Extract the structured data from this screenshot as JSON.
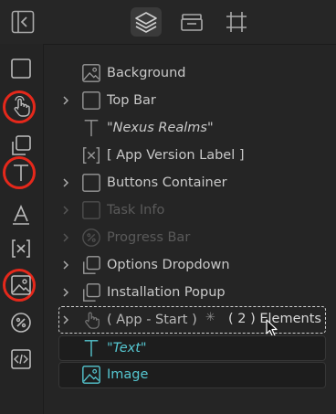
{
  "top_tabs": [
    {
      "name": "layers-icon",
      "active": true
    },
    {
      "name": "assets-icon",
      "active": false
    },
    {
      "name": "frame-icon",
      "active": false
    }
  ],
  "toolbar_tools": [
    "box-icon",
    "touch-icon",
    "copy-icon",
    "text-icon",
    "font-icon",
    "variable-icon",
    "image-icon",
    "percent-icon",
    "code-icon"
  ],
  "highlighted_tools": [
    "touch-icon",
    "text-icon",
    "image-icon"
  ],
  "tree": [
    {
      "label": "Background",
      "icon": "image"
    },
    {
      "label": "Top Bar",
      "icon": "box"
    },
    {
      "label": "\"Nexus Realms\"",
      "icon": "text"
    },
    {
      "label": "[ App Version Label ]",
      "icon": "variable"
    },
    {
      "label": "Buttons Container",
      "icon": "box"
    },
    {
      "label": "Task Info",
      "icon": "box"
    },
    {
      "label": "Progress Bar",
      "icon": "percent"
    },
    {
      "label": "Options Dropdown",
      "icon": "copy"
    },
    {
      "label": "Installation Popup",
      "icon": "copy"
    },
    {
      "label": "( App - Start )",
      "icon": "touch"
    },
    {
      "label": "\"Text\"",
      "icon": "text"
    },
    {
      "label": "Image",
      "icon": "image"
    }
  ],
  "group_count_label": "( 2 ) Elements",
  "colors": {
    "accent": "#55c6d0",
    "highlight_ring": "#e5281b",
    "background": "#252525"
  }
}
